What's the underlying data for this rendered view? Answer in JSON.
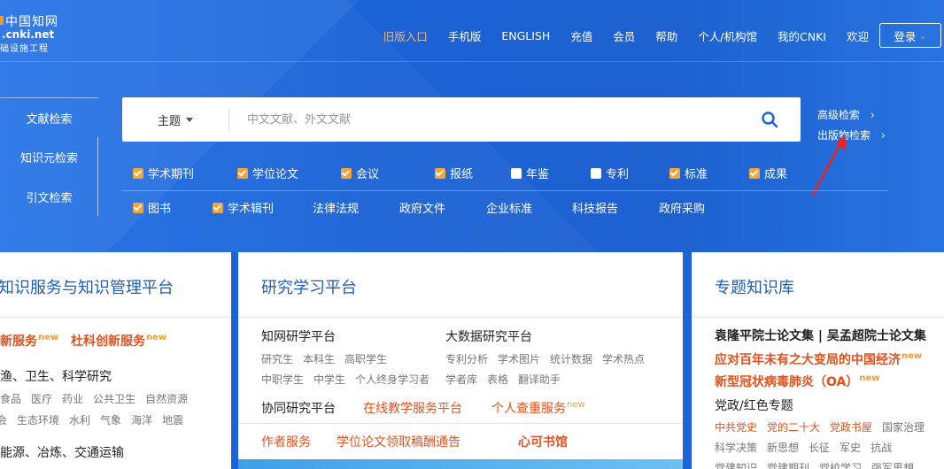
{
  "logo": {
    "cn": "中国知网",
    "url": ".cnki.net",
    "sub": "础设施工程"
  },
  "nav": {
    "items": [
      "旧版入口",
      "手机版",
      "ENGLISH",
      "充值",
      "会员",
      "帮助",
      "个人/机构馆",
      "我的CNKI",
      "欢迎"
    ],
    "login_label": "登录",
    "active_color": "#ffb35a"
  },
  "left_tabs": [
    "文献检索",
    "知识元检索",
    "引文检索"
  ],
  "search": {
    "scope": "主题",
    "placeholder": "中文文献、外文文献",
    "advanced": "高级检索",
    "publication": "出版物检索"
  },
  "filters": {
    "row1": [
      {
        "label": "学术期刊",
        "checked": true
      },
      {
        "label": "学位论文",
        "checked": true
      },
      {
        "label": "会议",
        "checked": true
      },
      {
        "label": "报纸",
        "checked": true
      },
      {
        "label": "年鉴",
        "checked": false
      },
      {
        "label": "专利",
        "checked": false
      },
      {
        "label": "标准",
        "checked": true
      },
      {
        "label": "成果",
        "checked": true
      }
    ],
    "row2": [
      {
        "label": "图书",
        "checked": true
      },
      {
        "label": "学术辑刊",
        "checked": true
      },
      {
        "label": "法律法规"
      },
      {
        "label": "政府文件"
      },
      {
        "label": "企业标准"
      },
      {
        "label": "科技报告"
      },
      {
        "label": "政府采购"
      }
    ]
  },
  "card1": {
    "title": "知识服务与知识管理平台",
    "link1": "新服务",
    "link2": "杜科创新服务",
    "new": "new",
    "sec1": "渔、卫生、科学研究",
    "sec1_items": [
      "食品",
      "医疗",
      "药业",
      "公共卫生",
      "自然资源"
    ],
    "sec1_items2": [
      "会",
      "生态环境",
      "水利",
      "气象",
      "海洋",
      "地震"
    ],
    "sec2": "能源、冶炼、交通运输"
  },
  "card2": {
    "title": "研究学习平台",
    "col1_title": "知网研学平台",
    "col1_row1": [
      "研究生",
      "本科生",
      "高职学生"
    ],
    "col1_row2": [
      "中职学生",
      "中学生",
      "个人终身学习者"
    ],
    "col2_title": "大数据研究平台",
    "col2_row1": [
      "专利分析",
      "学术图片",
      "统计数据",
      "学术热点"
    ],
    "col2_row2": [
      "学者库",
      "表格",
      "翻译助手"
    ],
    "collab": "协同研究平台",
    "online": "在线教学服务平台",
    "personal": "个人查重服务",
    "new": "new",
    "author": "作者服务",
    "thesis": "学位论文领取稿酬通告",
    "library": "心可书馆"
  },
  "card3": {
    "title": "专题知识库",
    "line1": "袁隆平院士论文集 | 吴孟超院士论文集",
    "line2": "应对百年未有之大变局的中国经济",
    "line3": "新型冠状病毒肺炎（OA）",
    "new": "new",
    "line4": "党政/红色专题",
    "red_items": [
      "中共党史",
      "党的二十大",
      "党政书屋"
    ],
    "gray_item": "国家治理",
    "row2": [
      "科学决策",
      "新思想",
      "长征",
      "军史",
      "抗战"
    ],
    "row3": [
      "党建知识",
      "党建期刊",
      "党校学习",
      "强军思想"
    ]
  }
}
